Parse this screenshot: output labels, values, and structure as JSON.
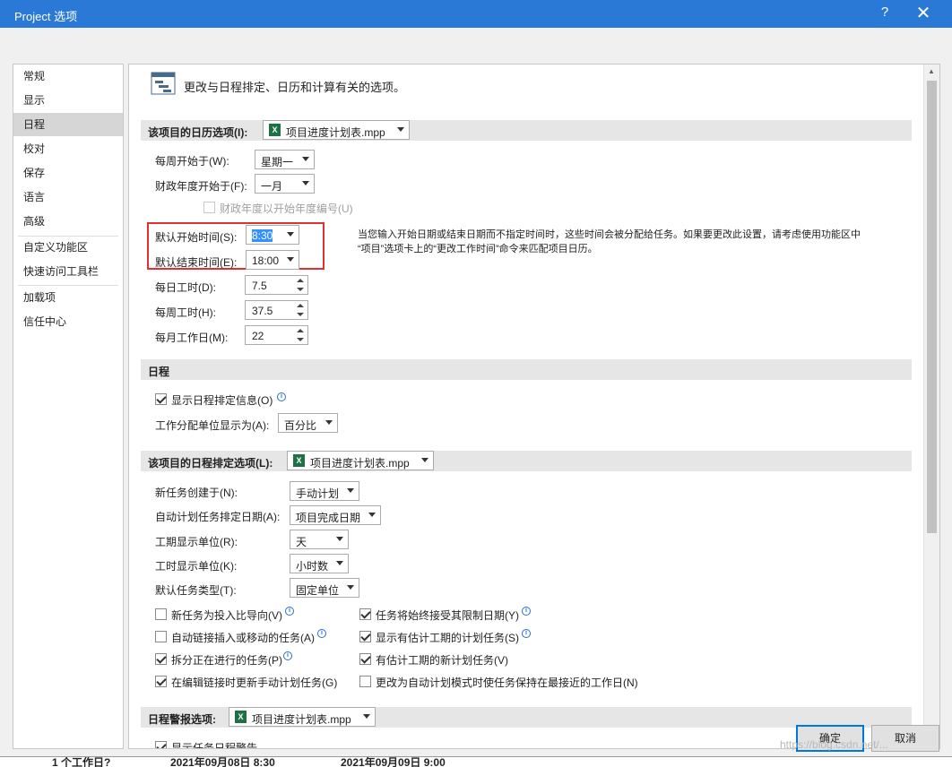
{
  "window": {
    "title": "Project 选项",
    "help": "?",
    "close": "✕"
  },
  "nav": {
    "items": [
      {
        "label": "常规"
      },
      {
        "label": "显示"
      },
      {
        "label": "日程"
      },
      {
        "label": "校对"
      },
      {
        "label": "保存"
      },
      {
        "label": "语言"
      },
      {
        "label": "高级"
      },
      {
        "label": "自定义功能区"
      },
      {
        "label": "快速访问工具栏"
      },
      {
        "label": "加载项"
      },
      {
        "label": "信任中心"
      }
    ],
    "selected": "日程"
  },
  "header": {
    "text": "更改与日程排定、日历和计算有关的选项。"
  },
  "calendar": {
    "section_title": "该项目的日历选项(I):",
    "project_file": "项目进度计划表.mpp",
    "week_start_label": "每周开始于(W):",
    "week_start_value": "星期一",
    "fiscal_start_label": "财政年度开始于(F):",
    "fiscal_start_value": "一月",
    "fiscal_numbering_label": "财政年度以开始年度编号(U)",
    "default_start_label": "默认开始时间(S):",
    "default_start_value": "8:30",
    "default_end_label": "默认结束时间(E):",
    "default_end_value": "18:00",
    "hours_per_day_label": "每日工时(D):",
    "hours_per_day_value": "7.5",
    "hours_per_week_label": "每周工时(H):",
    "hours_per_week_value": "37.5",
    "days_per_month_label": "每月工作日(M):",
    "days_per_month_value": "22",
    "note_line1": "当您输入开始日期或结束日期而不指定时间时，这些时间会被分配给任务。如果要更改此设置，请考虑使用功能区中",
    "note_line2": "“项目”选项卡上的“更改工作时间”命令来匹配项目日历。"
  },
  "schedule": {
    "section_title": "日程",
    "show_info_label": "显示日程排定信息(O)",
    "assign_units_label": "工作分配单位显示为(A):",
    "assign_units_value": "百分比"
  },
  "scheduling": {
    "section_title": "该项目的日程排定选项(L):",
    "project_file": "项目进度计划表.mpp",
    "new_task_label": "新任务创建于(N):",
    "new_task_value": "手动计划",
    "auto_date_label": "自动计划任务排定日期(A):",
    "auto_date_value": "项目完成日期",
    "duration_unit_label": "工期显示单位(R):",
    "duration_unit_value": "天",
    "work_unit_label": "工时显示单位(K):",
    "work_unit_value": "小时数",
    "task_type_label": "默认任务类型(T):",
    "task_type_value": "固定单位",
    "cb_effort": "新任务为投入比导向(V)",
    "cb_autolink": "自动链接插入或移动的任务(A)",
    "cb_split": "拆分正在进行的任务(P)",
    "cb_update_manual": "在编辑链接时更新手动计划任务(G)",
    "cb_honor": "任务将始终接受其限制日期(Y)",
    "cb_show_est": "显示有估计工期的计划任务(S)",
    "cb_new_est": "有估计工期的新计划任务(V)",
    "cb_keep_nearest": "更改为自动计划模式时使任务保持在最接近的工作日(N)"
  },
  "alerts": {
    "section_title": "日程警报选项:",
    "project_file": "项目进度计划表.mpp",
    "partial_label": "显示任务日程警告"
  },
  "buttons": {
    "ok": "确定",
    "cancel": "取消"
  },
  "background": {
    "row_label": "1 个工作日?",
    "start": "2021年09月08日 8:30",
    "finish": "2021年09月09日 9:00"
  },
  "watermark": "https://blog.csdn.net/..."
}
